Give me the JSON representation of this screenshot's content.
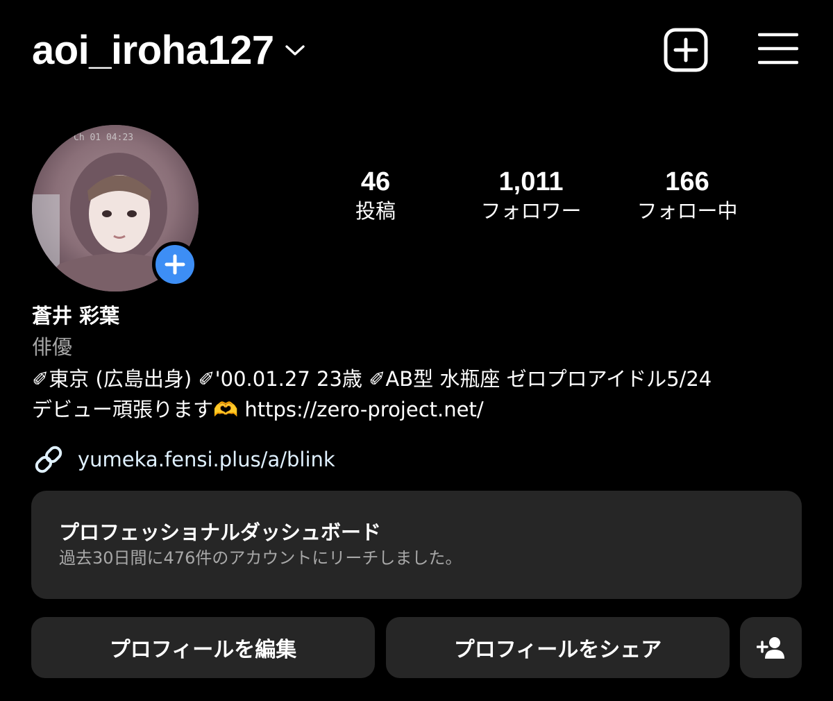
{
  "header": {
    "username": "aoi_iroha127",
    "icons": {
      "dropdown": "chevron-down-icon",
      "new_post": "plus-square-icon",
      "menu": "hamburger-menu-icon"
    }
  },
  "profile": {
    "avatar_overlay_text": "Ch 01 04:23",
    "stats": {
      "posts": {
        "value": "46",
        "label": "投稿"
      },
      "followers": {
        "value": "1,011",
        "label": "フォロワー"
      },
      "following": {
        "value": "166",
        "label": "フォロー中"
      }
    },
    "display_name": "蒼井 彩葉",
    "category": "俳優",
    "bio": "✐東京 (広島出身) ✐'00.01.27 23歳 ✐AB型 水瓶座 ゼロプロアイドル5/24\nデビュー頑張ります🫶 https://zero-project.net/",
    "link": "yumeka.fensi.plus/a/blink"
  },
  "dashboard": {
    "title": "プロフェッショナルダッシュボード",
    "subtitle": "過去30日間に476件のアカウントにリーチしました。"
  },
  "buttons": {
    "edit_profile": "プロフィールを編集",
    "share_profile": "プロフィールをシェア"
  },
  "colors": {
    "background": "#000000",
    "surface": "#262626",
    "accent_blue": "#3d8ef5",
    "secondary_text": "#a8a8a8"
  }
}
